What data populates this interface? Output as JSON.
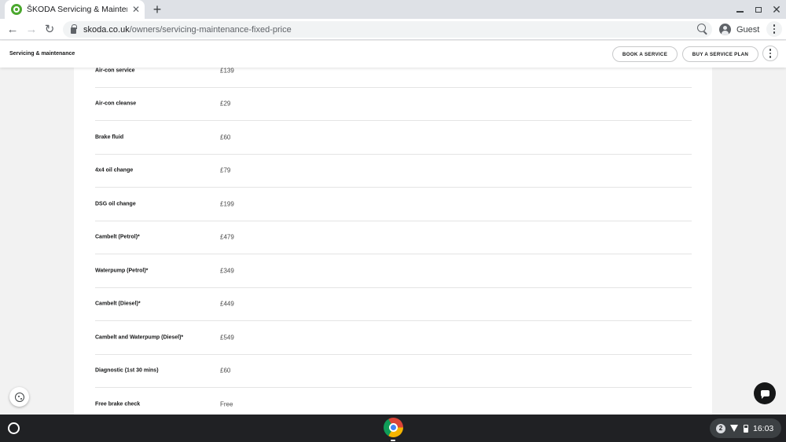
{
  "browser": {
    "tab_title": "ŠKODA Servicing & Maintenance",
    "tab_close": "✕",
    "new_tab": "+",
    "url_host": "skoda.co.uk",
    "url_path": "/owners/servicing-maintenance-fixed-price",
    "profile_label": "Guest",
    "window_close": "✕"
  },
  "subheader": {
    "title": "Servicing & maintenance",
    "book_service": "BOOK A SERVICE",
    "buy_plan": "BUY A SERVICE PLAN"
  },
  "prices": [
    {
      "label": "Air-con service",
      "price": "£139"
    },
    {
      "label": "Air-con cleanse",
      "price": "£29"
    },
    {
      "label": "Brake fluid",
      "price": "£60"
    },
    {
      "label": "4x4 oil change",
      "price": "£79"
    },
    {
      "label": "DSG oil change",
      "price": "£199"
    },
    {
      "label": "Cambelt (Petrol)*",
      "price": "£479"
    },
    {
      "label": "Waterpump (Petrol)*",
      "price": "£349"
    },
    {
      "label": "Cambelt (Diesel)*",
      "price": "£449"
    },
    {
      "label": "Cambelt and Waterpump (Diesel)*",
      "price": "£549"
    },
    {
      "label": "Diagnostic (1st 30 mins)",
      "price": "£60"
    },
    {
      "label": "Free brake check",
      "price": "Free"
    }
  ],
  "shelf": {
    "notification_count": "2",
    "time": "16:03"
  },
  "colors": {
    "brand_green": "#4ba82e",
    "shelf_bg": "#202124"
  },
  "icons": [
    "skoda-favicon-icon",
    "back-arrow-icon",
    "forward-arrow-icon",
    "reload-icon",
    "lock-icon",
    "zoom-icon",
    "guest-avatar-icon",
    "more-vert-icon",
    "cookie-icon",
    "chat-icon",
    "launcher-icon",
    "chrome-icon",
    "wifi-icon",
    "battery-icon"
  ]
}
